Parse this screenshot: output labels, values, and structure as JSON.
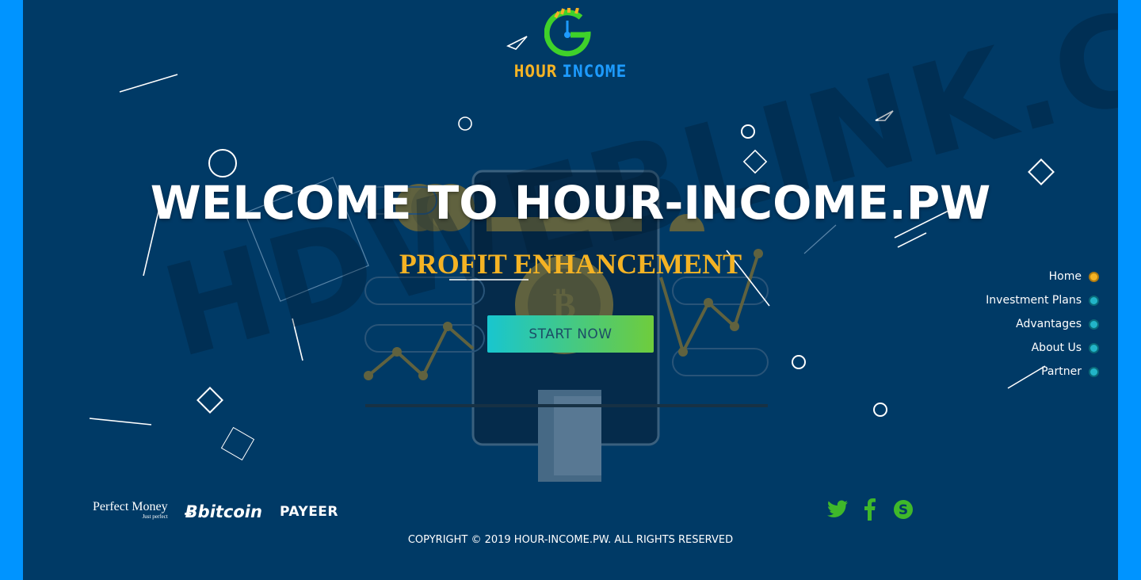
{
  "brand": {
    "word1": "HOUR",
    "word2": "INCOME"
  },
  "hero": {
    "title": "WELCOME TO HOUR-INCOME.PW",
    "subtitle": "PROFIT ENHANCEMENT",
    "cta_label": "START NOW"
  },
  "nav": {
    "items": [
      {
        "label": "Home",
        "active": true
      },
      {
        "label": "Investment Plans",
        "active": false
      },
      {
        "label": "Advantages",
        "active": false
      },
      {
        "label": "About Us",
        "active": false
      },
      {
        "label": "Partner",
        "active": false
      }
    ]
  },
  "payments": {
    "perfect_money": "Perfect Money",
    "perfect_money_tag": "Just perfect",
    "bitcoin": "bitcoin",
    "payeer": "PAYEER"
  },
  "social": {
    "icons": [
      "twitter-icon",
      "facebook-icon",
      "skype-icon"
    ]
  },
  "footer": {
    "copyright": "COPYRIGHT © 2019 HOUR-INCOME.PW. ALL RIGHTS RESERVED"
  },
  "watermark": "HDWEBLINK.COM",
  "colors": {
    "background": "#003a66",
    "frame": "#0094ff",
    "accent_gold": "#f5b324",
    "accent_blue": "#1d9bff",
    "logo_green": "#3fd12a",
    "cta_from": "#18c6cf",
    "cta_to": "#6fcc3c"
  }
}
